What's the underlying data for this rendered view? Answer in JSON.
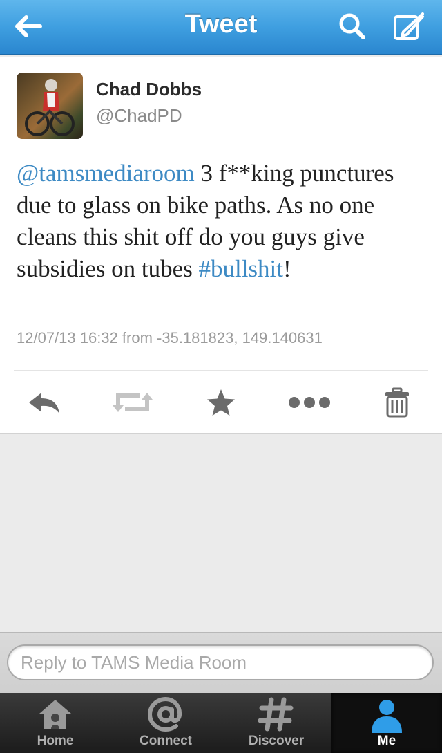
{
  "navbar": {
    "title": "Tweet"
  },
  "tweet": {
    "author_name": "Chad Dobbs",
    "author_handle": "@ChadPD",
    "mention": "@tamsmediaroom",
    "text_part1": " 3 f**king punctures due to glass on bike paths. As no one cleans this shit off do you guys give subsidies on tubes ",
    "hashtag": "#bullshit",
    "text_part2": "!",
    "meta": "12/07/13 16:32 from -35.181823, 149.140631"
  },
  "reply": {
    "placeholder": "Reply to TAMS Media Room"
  },
  "tabs": [
    {
      "label": "Home"
    },
    {
      "label": "Connect"
    },
    {
      "label": "Discover"
    },
    {
      "label": "Me"
    }
  ],
  "colors": {
    "accent": "#3d8ac4",
    "nav_blue": "#3f9fe0",
    "tab_active": "#2f9de8"
  }
}
